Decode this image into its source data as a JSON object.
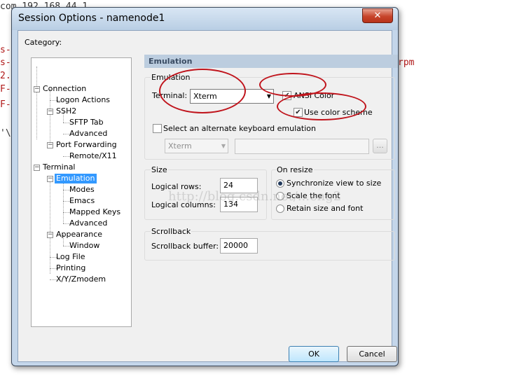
{
  "background": {
    "lines": [
      {
        "text": "com 192.168.44.1",
        "color": "dark"
      },
      {
        "text": "s-",
        "color": "red"
      },
      {
        "text": "s-",
        "color": "red"
      },
      {
        "text": "2.",
        "color": "red"
      },
      {
        "text": "F-",
        "color": "red"
      },
      {
        "text": "F-",
        "color": "red"
      },
      {
        "text": "'\\",
        "color": "dark"
      }
    ],
    "right_text": "rpm"
  },
  "dialog": {
    "title": "Session Options - namenode1",
    "close_glyph": "✕"
  },
  "category": {
    "label": "Category:",
    "tree": [
      {
        "id": "connection",
        "label": "Connection"
      },
      {
        "id": "logon-actions",
        "label": "Logon Actions"
      },
      {
        "id": "ssh2",
        "label": "SSH2"
      },
      {
        "id": "sftp-tab",
        "label": "SFTP Tab"
      },
      {
        "id": "advanced-ssh",
        "label": "Advanced"
      },
      {
        "id": "port-forwarding",
        "label": "Port Forwarding"
      },
      {
        "id": "remote-x11",
        "label": "Remote/X11"
      },
      {
        "id": "terminal",
        "label": "Terminal"
      },
      {
        "id": "emulation",
        "label": "Emulation",
        "selected": true
      },
      {
        "id": "modes",
        "label": "Modes"
      },
      {
        "id": "emacs",
        "label": "Emacs"
      },
      {
        "id": "mapped-keys",
        "label": "Mapped Keys"
      },
      {
        "id": "advanced-term",
        "label": "Advanced"
      },
      {
        "id": "appearance",
        "label": "Appearance"
      },
      {
        "id": "window",
        "label": "Window"
      },
      {
        "id": "log-file",
        "label": "Log File"
      },
      {
        "id": "printing",
        "label": "Printing"
      },
      {
        "id": "xyzmodem",
        "label": "X/Y/Zmodem"
      }
    ]
  },
  "panel": {
    "header": "Emulation",
    "emulation": {
      "group_label": "Emulation",
      "terminal_label": "Terminal:",
      "terminal_value": "Xterm",
      "ansi_color_label": "ANSI Color",
      "ansi_color_checked": true,
      "use_color_scheme_label": "Use color scheme",
      "use_color_scheme_checked": true,
      "alt_keyboard_label": "Select an alternate keyboard emulation",
      "alt_keyboard_checked": false,
      "alt_keyboard_value": "Xterm",
      "browse_label": "..."
    },
    "size": {
      "group_label": "Size",
      "rows_label": "Logical rows:",
      "rows_value": "24",
      "columns_label": "Logical columns:",
      "columns_value": "134"
    },
    "on_resize": {
      "group_label": "On resize",
      "options": [
        {
          "label": "Synchronize view to size",
          "selected": true
        },
        {
          "label": "Scale the font",
          "selected": false
        },
        {
          "label": "Retain size and font",
          "selected": false
        }
      ]
    },
    "scrollback": {
      "group_label": "Scrollback",
      "buffer_label": "Scrollback buffer:",
      "buffer_value": "20000"
    }
  },
  "buttons": {
    "ok": "OK",
    "cancel": "Cancel"
  },
  "watermark": "http://blog.csdn.net/...eng2",
  "annotation_color": "#c0141c"
}
